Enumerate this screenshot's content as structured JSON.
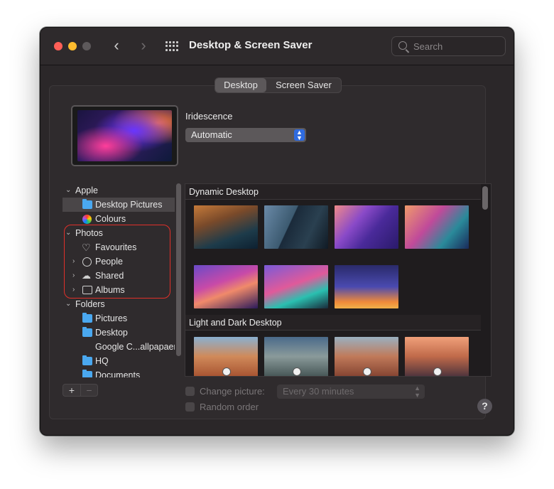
{
  "window": {
    "title": "Desktop & Screen Saver",
    "back_glyph": "‹",
    "forward_glyph": "›"
  },
  "search": {
    "placeholder": "Search"
  },
  "tabs": [
    {
      "label": "Desktop",
      "selected": true
    },
    {
      "label": "Screen Saver",
      "selected": false
    }
  ],
  "current_wallpaper": {
    "name": "Iridescence",
    "mode": "Automatic"
  },
  "sidebar": {
    "groups": [
      {
        "label": "Apple",
        "expanded": true,
        "items": [
          {
            "label": "Desktop Pictures",
            "icon": "folder-icon",
            "selected": true
          },
          {
            "label": "Colours",
            "icon": "color-wheel-icon"
          }
        ]
      },
      {
        "label": "Photos",
        "expanded": true,
        "items": [
          {
            "label": "Favourites",
            "icon": "heart-icon"
          },
          {
            "label": "People",
            "icon": "person-icon",
            "expandable": true
          },
          {
            "label": "Shared",
            "icon": "cloud-icon",
            "expandable": true
          },
          {
            "label": "Albums",
            "icon": "folder-outline-icon",
            "expandable": true
          }
        ]
      },
      {
        "label": "Folders",
        "expanded": true,
        "items": [
          {
            "label": "Pictures",
            "icon": "folder-icon"
          },
          {
            "label": "Desktop",
            "icon": "folder-icon"
          },
          {
            "label": "Google C...allpapaer",
            "icon": ""
          },
          {
            "label": "HQ",
            "icon": "folder-icon"
          },
          {
            "label": "Documents",
            "icon": "folder-icon"
          }
        ]
      }
    ],
    "add_label": "+",
    "remove_label": "−"
  },
  "gallery": {
    "sections": [
      {
        "title": "Dynamic Desktop",
        "count": 7
      },
      {
        "title": "Light and Dark Desktop",
        "count": 4
      }
    ]
  },
  "options": {
    "change_picture_label": "Change picture:",
    "change_picture_checked": false,
    "interval": "Every 30 minutes",
    "random_order_label": "Random order",
    "random_order_checked": false
  },
  "help_label": "?",
  "colors": {
    "window_bg": "#2b2729",
    "accent": "#2f6be0",
    "annotation": "#e0302a"
  }
}
